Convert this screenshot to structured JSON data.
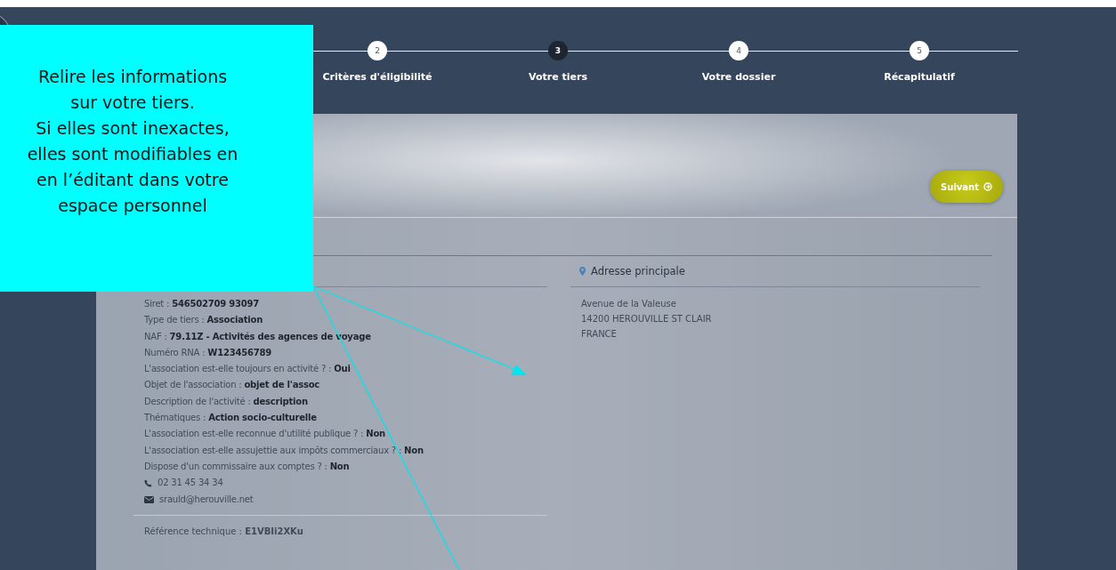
{
  "callout": {
    "lines": [
      "Relire les informations",
      "sur votre tiers.",
      "Si elles sont inexactes,",
      "elles sont modifiables en",
      "en l’éditant dans votre",
      "espace personnel"
    ]
  },
  "steps": [
    {
      "number": "2",
      "label": "Critères d'éligibilité",
      "selected": false
    },
    {
      "number": "3",
      "label": "Votre tiers",
      "selected": true
    },
    {
      "number": "4",
      "label": "Votre dossier",
      "selected": false
    },
    {
      "number": "5",
      "label": "Récapitulatif",
      "selected": false
    }
  ],
  "next_button": {
    "label": "Suivant"
  },
  "tiers": {
    "rows": [
      {
        "kind": "text",
        "text": "Siret : **546502709 93097**"
      },
      {
        "kind": "text",
        "text": "Type de tiers : **Association**"
      },
      {
        "kind": "text",
        "text": "NAF : **79.11Z - Activités des agences de voyage**"
      },
      {
        "kind": "text",
        "text": "Numéro RNA : **W123456789**"
      },
      {
        "kind": "text",
        "text": "L'association est-elle toujours en activité ? : **Oui**"
      },
      {
        "kind": "text",
        "text": "Objet de l'association : **objet de l'assoc**"
      },
      {
        "kind": "text",
        "text": "Description de l'activité : **description**"
      },
      {
        "kind": "text",
        "text": "Thématiques : **Action socio-culturelle**"
      },
      {
        "kind": "text",
        "text": "L'association est-elle reconnue d'utilité publique ? : **Non**"
      },
      {
        "kind": "text",
        "text": "L'association est-elle assujettie aux impôts commerciaux ? : **Non**"
      },
      {
        "kind": "text",
        "text": "Dispose d'un commissaire aux comptes ? : **Non**"
      },
      {
        "kind": "phone",
        "text": "02 31 45 34 34"
      },
      {
        "kind": "email",
        "text": "srauld@herouville.net"
      }
    ],
    "reference": "Référence technique : **E1VBIi2XKu**"
  },
  "address": {
    "title": "Adresse principale",
    "lines": [
      "Avenue de la Valeuse",
      "14200 HEROUVILLE ST CLAIR",
      "FRANCE"
    ]
  }
}
